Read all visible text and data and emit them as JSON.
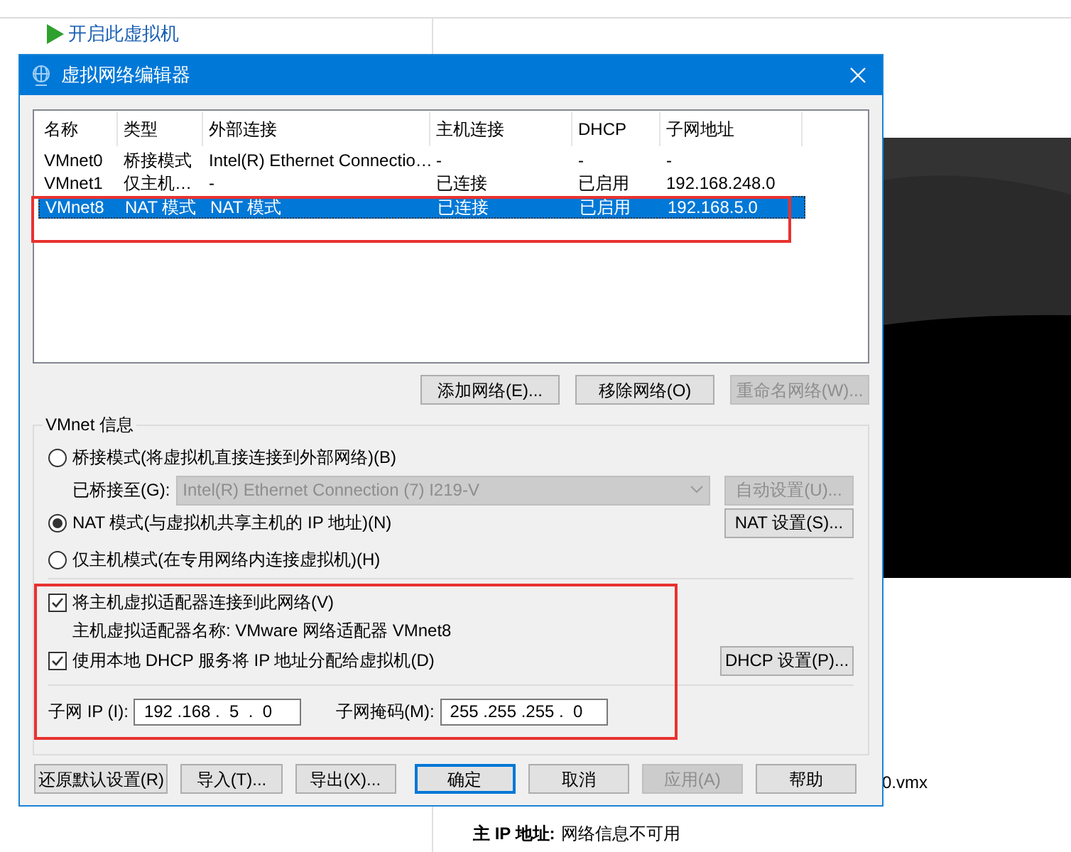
{
  "background": {
    "start_link": "开启此虚拟机",
    "file_fragment": "0.vmx",
    "ip_label": "主 IP 地址:",
    "ip_value": "网络信息不可用"
  },
  "dialog": {
    "title": "虚拟网络编辑器",
    "table": {
      "columns": [
        "名称",
        "类型",
        "外部连接",
        "主机连接",
        "DHCP",
        "子网地址"
      ],
      "rows": [
        {
          "cells": [
            "VMnet0",
            "桥接模式",
            "Intel(R) Ethernet Connectio…",
            "-",
            "-",
            "-"
          ],
          "selected": false
        },
        {
          "cells": [
            "VMnet1",
            "仅主机…",
            "-",
            "已连接",
            "已启用",
            "192.168.248.0"
          ],
          "selected": false
        },
        {
          "cells": [
            "VMnet8",
            "NAT 模式",
            "NAT 模式",
            "已连接",
            "已启用",
            "192.168.5.0"
          ],
          "selected": true
        }
      ]
    },
    "list_buttons": [
      {
        "label": "添加网络(E)...",
        "disabled": false
      },
      {
        "label": "移除网络(O)",
        "disabled": false
      },
      {
        "label": "重命名网络(W)...",
        "disabled": true
      }
    ],
    "group_title": "VMnet 信息",
    "modes": [
      {
        "label": "桥接模式(将虚拟机直接连接到外部网络)(B)",
        "selected": false
      },
      {
        "label": "NAT 模式(与虚拟机共享主机的 IP 地址)(N)",
        "selected": true
      },
      {
        "label": "仅主机模式(在专用网络内连接虚拟机)(H)",
        "selected": false
      }
    ],
    "bridge": {
      "label": "已桥接至(G):",
      "value": "Intel(R) Ethernet Connection (7) I219-V",
      "disabled": true,
      "button": "自动设置(U)..."
    },
    "nat_button": "NAT 设置(S)...",
    "connect_adapter": {
      "label": "将主机虚拟适配器连接到此网络(V)",
      "checked": true
    },
    "adapter_name": "主机虚拟适配器名称: VMware 网络适配器 VMnet8",
    "use_dhcp": {
      "label": "使用本地 DHCP 服务将 IP 地址分配给虚拟机(D)",
      "checked": true
    },
    "dhcp_button": "DHCP 设置(P)...",
    "subnet_ip": {
      "label": "子网 IP (I):",
      "value": "192 .168 .  5  .  0"
    },
    "subnet_mask": {
      "label": "子网掩码(M):",
      "value": "255 .255 .255 .  0"
    },
    "footer_buttons": [
      {
        "label": "还原默认设置(R)",
        "kind": "normal"
      },
      {
        "label": "导入(T)...",
        "kind": "normal"
      },
      {
        "label": "导出(X)...",
        "kind": "normal"
      },
      {
        "label": "确定",
        "kind": "default"
      },
      {
        "label": "取消",
        "kind": "normal"
      },
      {
        "label": "应用(A)",
        "kind": "disabled"
      },
      {
        "label": "帮助",
        "kind": "normal"
      }
    ]
  }
}
